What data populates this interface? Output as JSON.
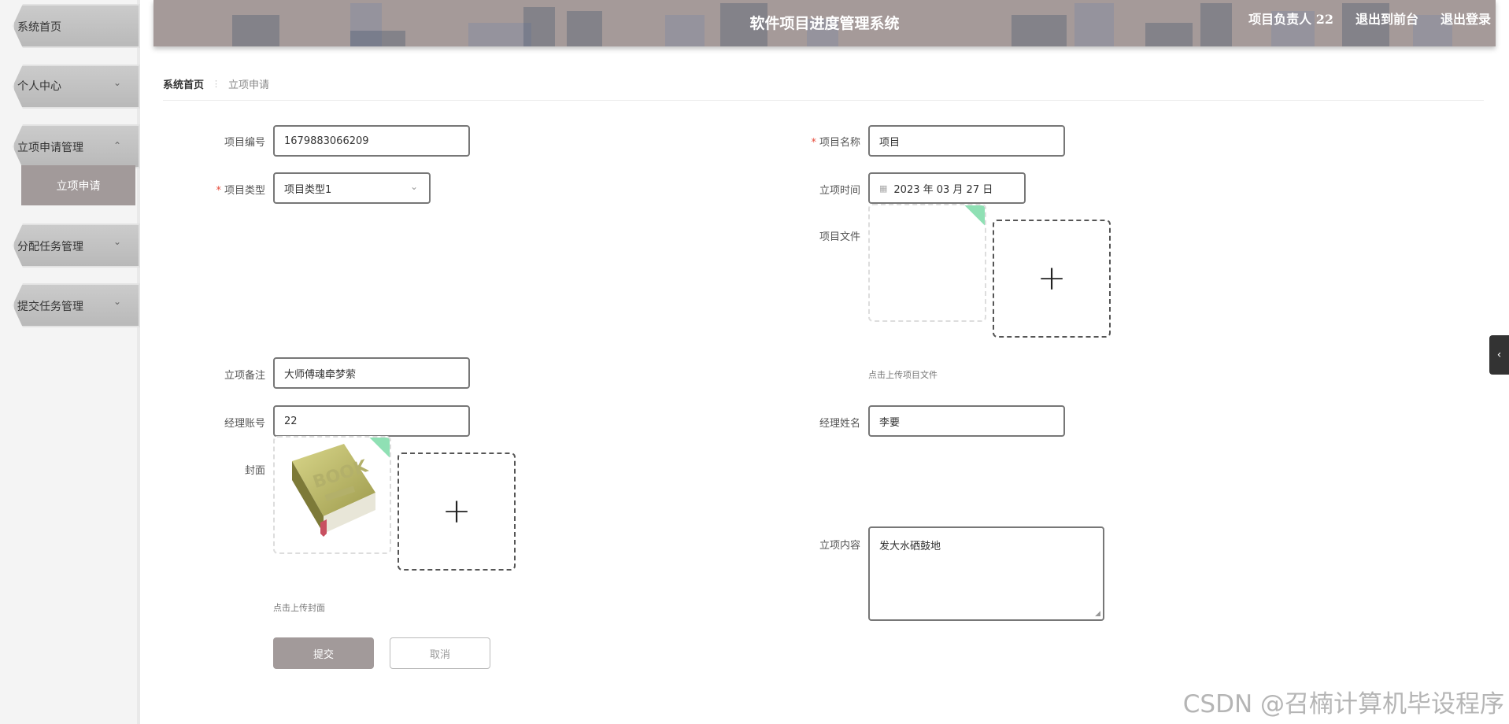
{
  "sidebar": {
    "items": [
      {
        "label": "系统首页",
        "arrow": ""
      },
      {
        "label": "个人中心",
        "arrow": "⌄"
      },
      {
        "label": "立项申请管理",
        "arrow": "⌃"
      },
      {
        "label": "分配任务管理",
        "arrow": "⌄"
      },
      {
        "label": "提交任务管理",
        "arrow": "⌄"
      }
    ],
    "submenu_active": "立项申请"
  },
  "header": {
    "title": "软件项目进度管理系统",
    "user": "项目负责人 22",
    "exit_front": "退出到前台",
    "logout": "退出登录"
  },
  "breadcrumb": {
    "home": "系统首页",
    "separator": "⋮",
    "current": "立项申请"
  },
  "form": {
    "project_no": {
      "label": "项目编号",
      "value": "1679883066209"
    },
    "project_name": {
      "label": "项目名称",
      "value": "项目",
      "required": "*"
    },
    "project_type": {
      "label": "项目类型",
      "value": "项目类型1",
      "required": "*"
    },
    "project_time": {
      "label": "立项时间",
      "value": "2023 年 03 月 27 日"
    },
    "project_file": {
      "label": "项目文件",
      "hint": "点击上传项目文件"
    },
    "remark": {
      "label": "立项备注",
      "value": "大师傅魂牵梦萦"
    },
    "manager_account": {
      "label": "经理账号",
      "value": "22"
    },
    "manager_name": {
      "label": "经理姓名",
      "value": "李要"
    },
    "cover": {
      "label": "封面",
      "hint": "点击上传封面",
      "image_text": "BOOK"
    },
    "content": {
      "label": "立项内容",
      "value": "发大水硒鼓地"
    },
    "submit": "提交",
    "cancel": "取消"
  },
  "icons": {
    "plus": "+",
    "calendar": "▦",
    "chevron": "⌄",
    "side_tab": "‹"
  },
  "watermark": "CSDN @召楠计算机毕设程序"
}
